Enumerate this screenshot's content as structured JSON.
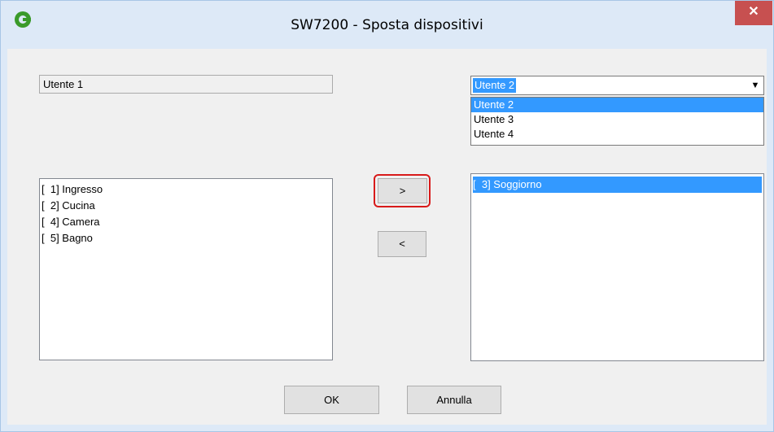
{
  "window": {
    "title": "SW7200 - Sposta dispositivi",
    "close_label": "✕",
    "accent_color": "#dde9f7",
    "close_color": "#c75050"
  },
  "source_user": {
    "value": "Utente 1"
  },
  "target_user": {
    "selected": "Utente 2",
    "options": [
      "Utente 2",
      "Utente 3",
      "Utente 4"
    ],
    "arrow": "▼"
  },
  "source_list": {
    "items": [
      "[  1] Ingresso",
      "[  2] Cucina",
      "[  4] Camera",
      "[  5] Bagno"
    ]
  },
  "target_list": {
    "items": [
      "[  3] Soggiorno"
    ]
  },
  "buttons": {
    "move_right": ">",
    "move_left": "<",
    "ok": "OK",
    "cancel": "Annulla"
  },
  "highlight_color": "#d81a1a",
  "selection_color": "#3399ff"
}
